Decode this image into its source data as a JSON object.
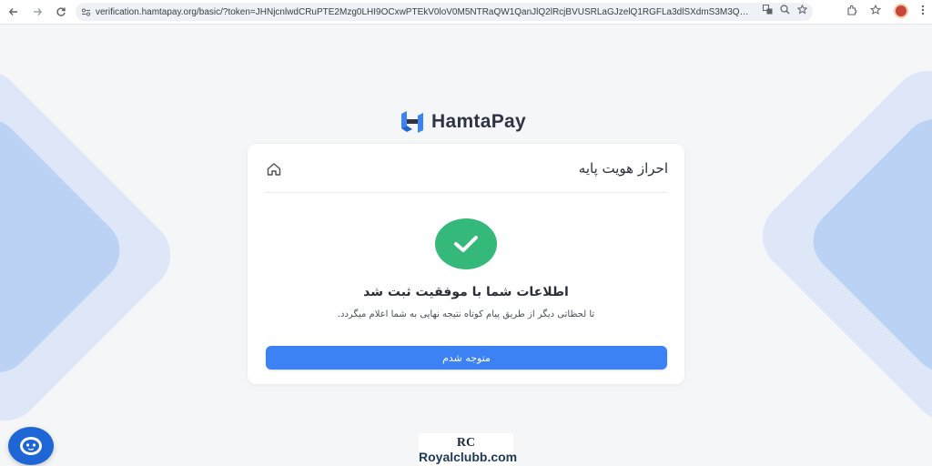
{
  "browser": {
    "url": "verification.hamtapay.org/basic/?token=JHNjcnlwdCRuPTE2Mzg0LHI9OCxwPTEkV0loV0M5NTRaQW1QanJlQ2lRcjBVUSRLaGJzelQ1RGFLa3dlSXdmS3M3QTMyVmFnK1R...",
    "nav_icons": [
      "back-icon",
      "forward-icon",
      "reload-icon"
    ],
    "omnibox_icons": [
      "site-info-icon",
      "translate-icon",
      "zoom-icon",
      "star-icon"
    ],
    "right_icons": [
      "extensions-icon",
      "bookmarks-icon",
      "profile-avatar",
      "menu-icon"
    ]
  },
  "brand": {
    "logo_text": "HamtaPay",
    "primary_color": "#3d82f5",
    "success_color": "#35b97a"
  },
  "card": {
    "title": "احراز هویت پایه",
    "success_title": "اطلاعات شما با موفقیت ثبت شد",
    "success_message": "تا لحظاتی دیگر از طریق پیام کوتاه نتیجه نهایی به شما اعلام میگردد.",
    "button_label": "متوجه شدم"
  },
  "watermark": {
    "mark": "RC",
    "text": "Royalclubb.com"
  }
}
